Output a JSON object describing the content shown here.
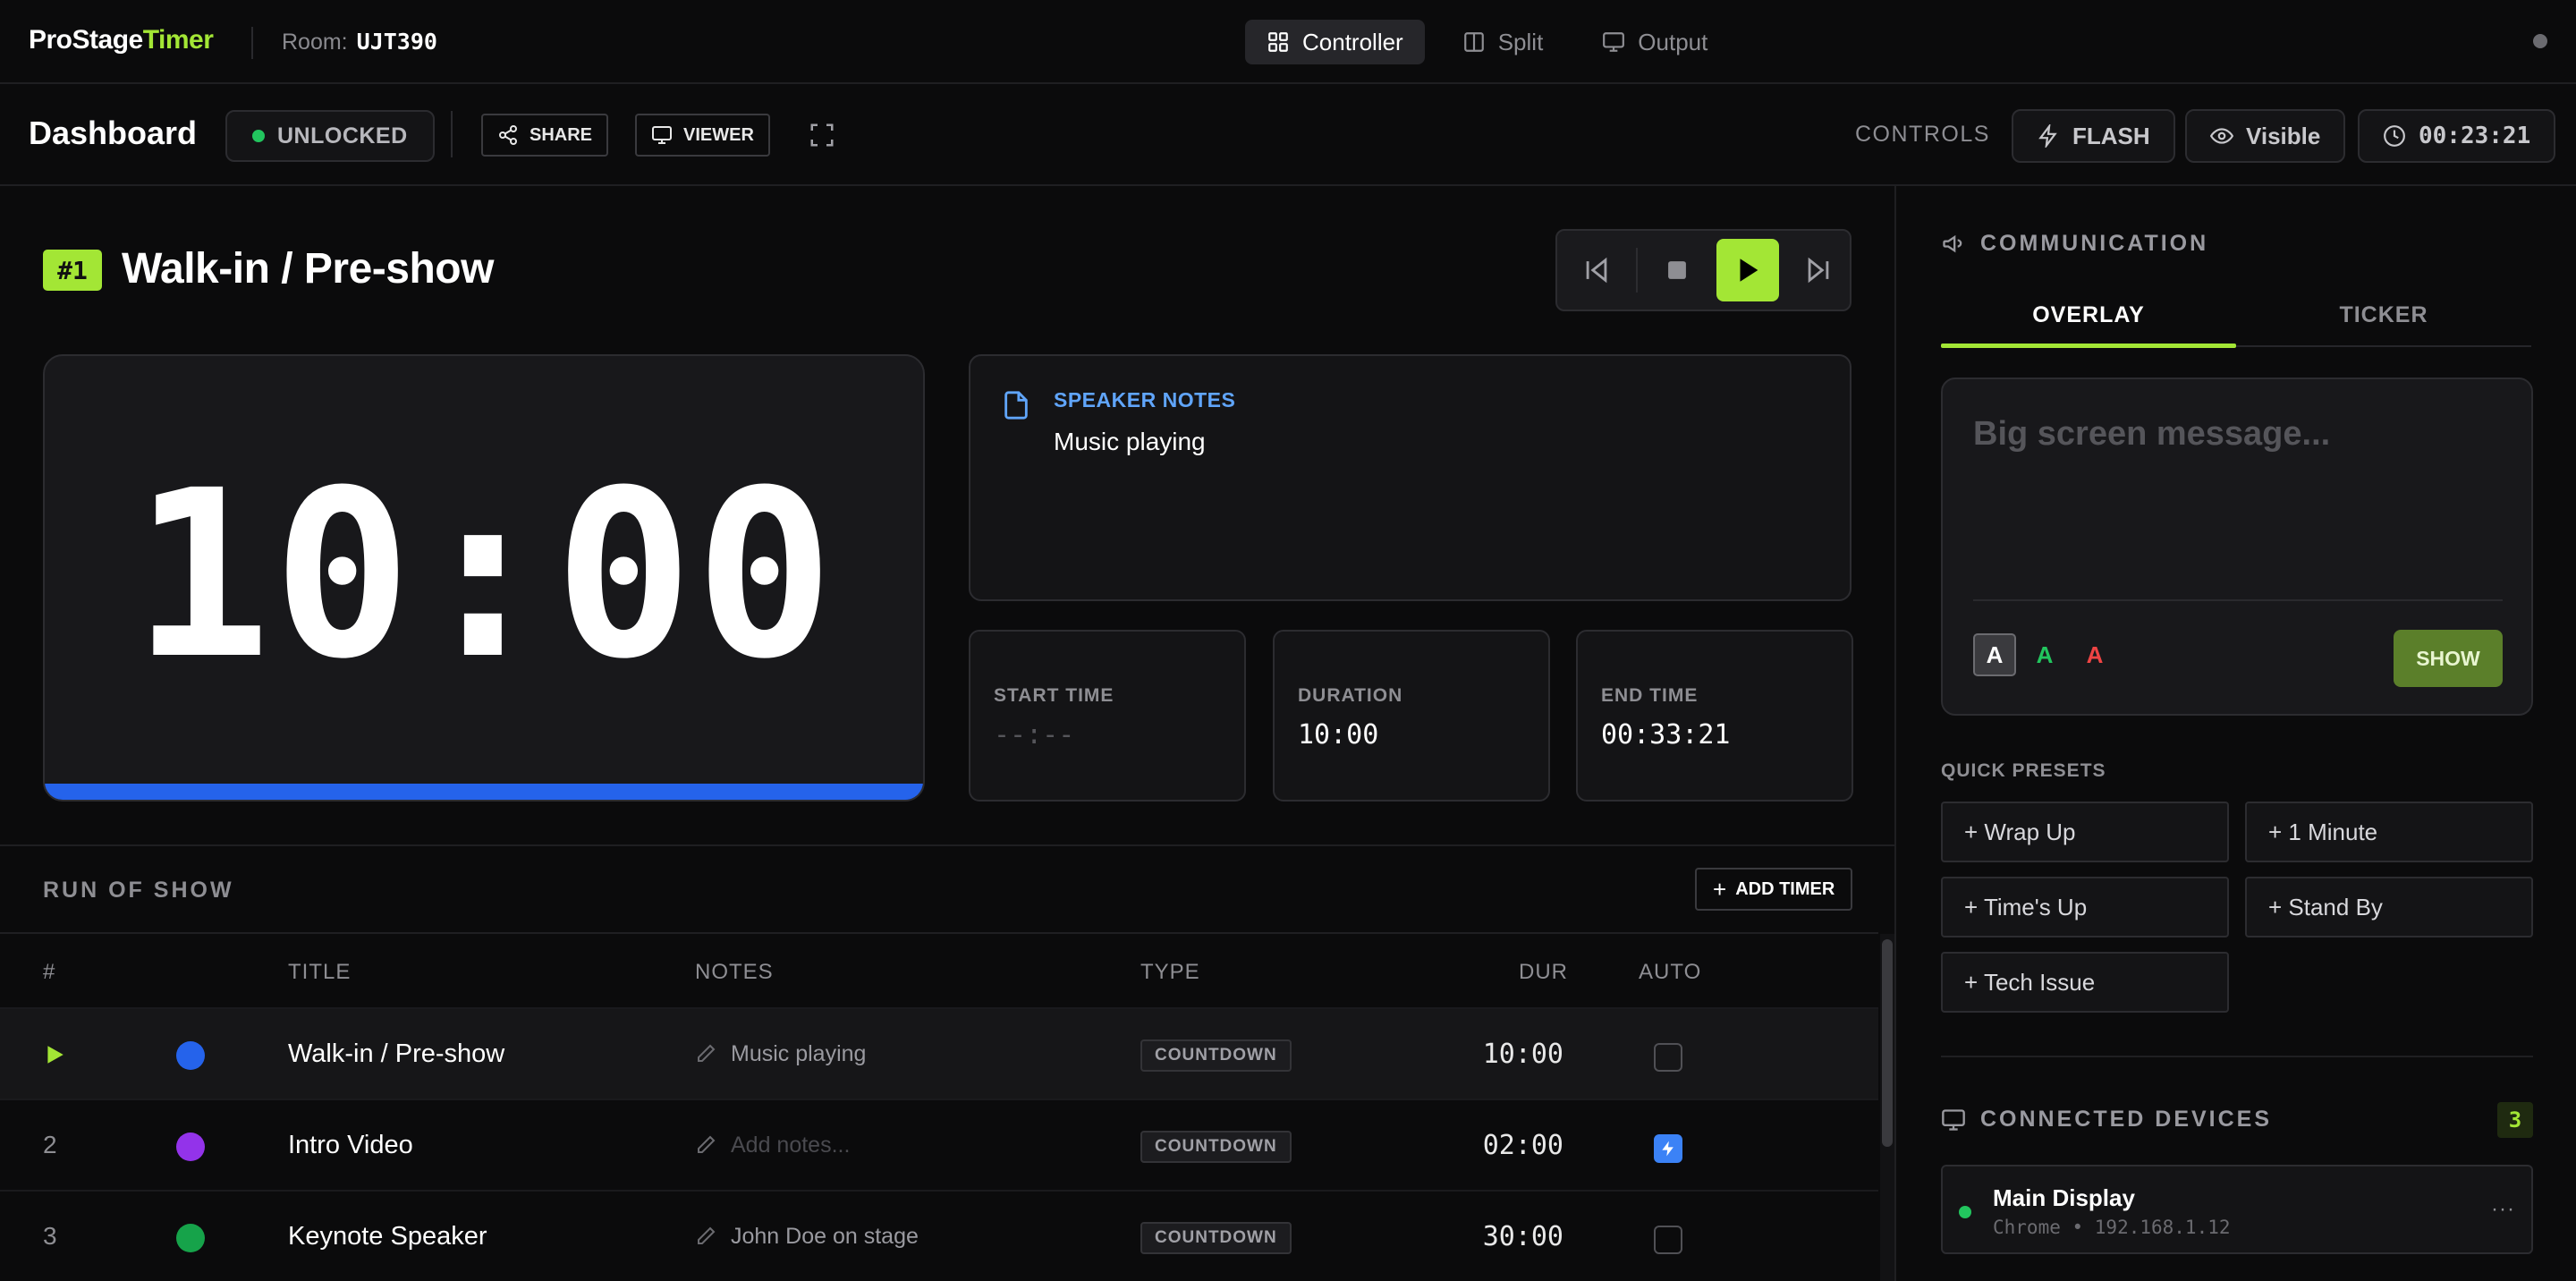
{
  "header": {
    "brand_part1": "ProStage",
    "brand_part2": "Timer",
    "room_label": "Room:",
    "room_code": "UJT390",
    "nav_tabs": [
      {
        "label": "Controller",
        "icon": "grid-icon",
        "active": true
      },
      {
        "label": "Split",
        "icon": "split-icon",
        "active": false
      },
      {
        "label": "Output",
        "icon": "monitor-icon",
        "active": false
      }
    ]
  },
  "toolbar": {
    "title": "Dashboard",
    "lock_status": "UNLOCKED",
    "share_label": "SHARE",
    "viewer_label": "VIEWER",
    "controls_label": "CONTROLS",
    "flash_label": "FLASH",
    "visible_label": "Visible",
    "clock": "00:23:21"
  },
  "current_cue": {
    "badge": "#1",
    "title": "Walk-in / Pre-show",
    "time": "10:00",
    "progress_fraction": 1.0,
    "notes_label": "SPEAKER NOTES",
    "notes_text": "Music playing",
    "start_time_label": "START TIME",
    "start_time": "--:--",
    "duration_label": "DURATION",
    "duration": "10:00",
    "end_time_label": "END TIME",
    "end_time": "00:33:21"
  },
  "run_of_show": {
    "title": "RUN OF SHOW",
    "add_label": "ADD TIMER",
    "columns": {
      "num": "#",
      "title": "TITLE",
      "notes": "NOTES",
      "type": "TYPE",
      "dur": "DUR",
      "auto": "AUTO"
    },
    "rows": [
      {
        "num": "",
        "playing": true,
        "color": "#2563eb",
        "title": "Walk-in / Pre-show",
        "notes": "Music playing",
        "notes_placeholder": false,
        "type": "COUNTDOWN",
        "dur": "10:00",
        "auto": false
      },
      {
        "num": "2",
        "playing": false,
        "color": "#9333ea",
        "title": "Intro Video",
        "notes": "Add notes...",
        "notes_placeholder": true,
        "type": "COUNTDOWN",
        "dur": "02:00",
        "auto": true
      },
      {
        "num": "3",
        "playing": false,
        "color": "#16a34a",
        "title": "Keynote Speaker",
        "notes": "John Doe on stage",
        "notes_placeholder": false,
        "type": "COUNTDOWN",
        "dur": "30:00",
        "auto": false
      }
    ]
  },
  "communication": {
    "title": "COMMUNICATION",
    "tab_overlay": "OVERLAY",
    "tab_ticker": "TICKER",
    "message_placeholder": "Big screen message...",
    "color_options": [
      {
        "label": "A",
        "color": "#ffffff"
      },
      {
        "label": "A",
        "color": "#22c55e"
      },
      {
        "label": "A",
        "color": "#ef4444"
      }
    ],
    "show_label": "SHOW",
    "quick_presets_title": "QUICK PRESETS",
    "presets": [
      "+ Wrap Up",
      "+ 1 Minute",
      "+ Time's Up",
      "+ Stand By",
      "+ Tech Issue"
    ]
  },
  "devices": {
    "title": "CONNECTED DEVICES",
    "count": "3",
    "items": [
      {
        "name": "Main Display",
        "meta": "Chrome • 192.168.1.12",
        "more": "···"
      }
    ]
  }
}
